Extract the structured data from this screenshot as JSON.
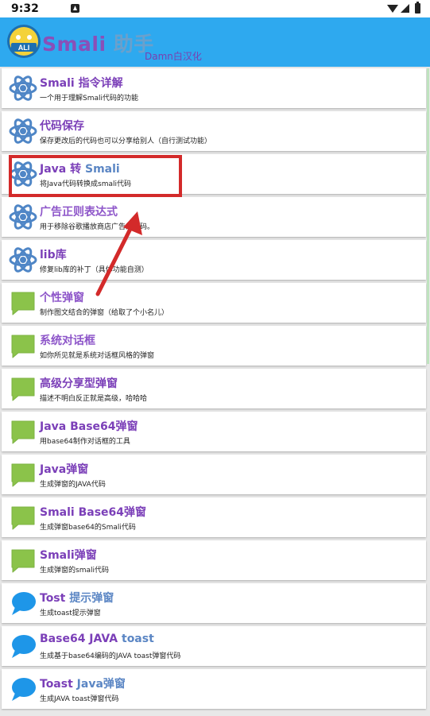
{
  "status": {
    "time": "9:32"
  },
  "header": {
    "title": "Smali",
    "title_zh": "助手",
    "subtitle": "Damn白汉化"
  },
  "items": [
    {
      "title": "Smali 指令详解",
      "desc": "一个用于理解Smali代码的功能",
      "icon": "atom-icon"
    },
    {
      "title": "代码保存",
      "desc": "保存更改后的代码也可以分享给别人（自行测试功能）",
      "icon": "atom-icon"
    },
    {
      "title_a": "Java 转 ",
      "title_b": "Smali",
      "desc": "将Java代码转换成smali代码",
      "icon": "atom-icon"
    },
    {
      "title": "广告正则表达式",
      "desc": "用于移除谷歌播放商店广告的代码。",
      "icon": "atom-icon"
    },
    {
      "title": "lib库",
      "desc": "修复lib库的补丁（具体功能自测）",
      "icon": "atom-icon"
    },
    {
      "title": "个性弹窗",
      "desc": "制作图文结合的弹窗（给取了个小名儿）",
      "icon": "chat-square-icon"
    },
    {
      "title": "系统对话框",
      "desc": "如你所见就是系统对话框风格的弹窗",
      "icon": "chat-square-icon"
    },
    {
      "title": "高级分享型弹窗",
      "desc": "描述不明白反正就是高级，哈哈哈",
      "icon": "chat-square-icon"
    },
    {
      "title": "Java Base64弹窗",
      "desc": "用base64制作对话框的工具",
      "icon": "chat-square-icon"
    },
    {
      "title": "Java弹窗",
      "desc": "生成弹窗的JAVA代码",
      "icon": "chat-square-icon"
    },
    {
      "title": "Smali Base64弹窗",
      "desc": "生成弹窗base64的Smali代码",
      "icon": "chat-square-icon"
    },
    {
      "title": "Smali弹窗",
      "desc": "生成弹窗的smali代码",
      "icon": "chat-square-icon"
    },
    {
      "title_a": "Tost ",
      "title_b": "提示弹窗",
      "desc": "生成toast提示弹窗",
      "icon": "chat-bubble-icon"
    },
    {
      "title_a": "Base64 JAVA ",
      "title_b": "toast",
      "desc": "生成基于base64编码的JAVA toast弹窗代码",
      "icon": "chat-bubble-icon"
    },
    {
      "title_a": "Toast ",
      "title_b": "Java弹窗",
      "desc": "生成JAVA toast弹窗代码",
      "icon": "chat-bubble-icon"
    }
  ],
  "colors": {
    "appbar": "#2ea9ef",
    "highlight": "#d32a2a",
    "square_icon": "#8bc34a",
    "bubble_icon": "#1e96e8"
  }
}
